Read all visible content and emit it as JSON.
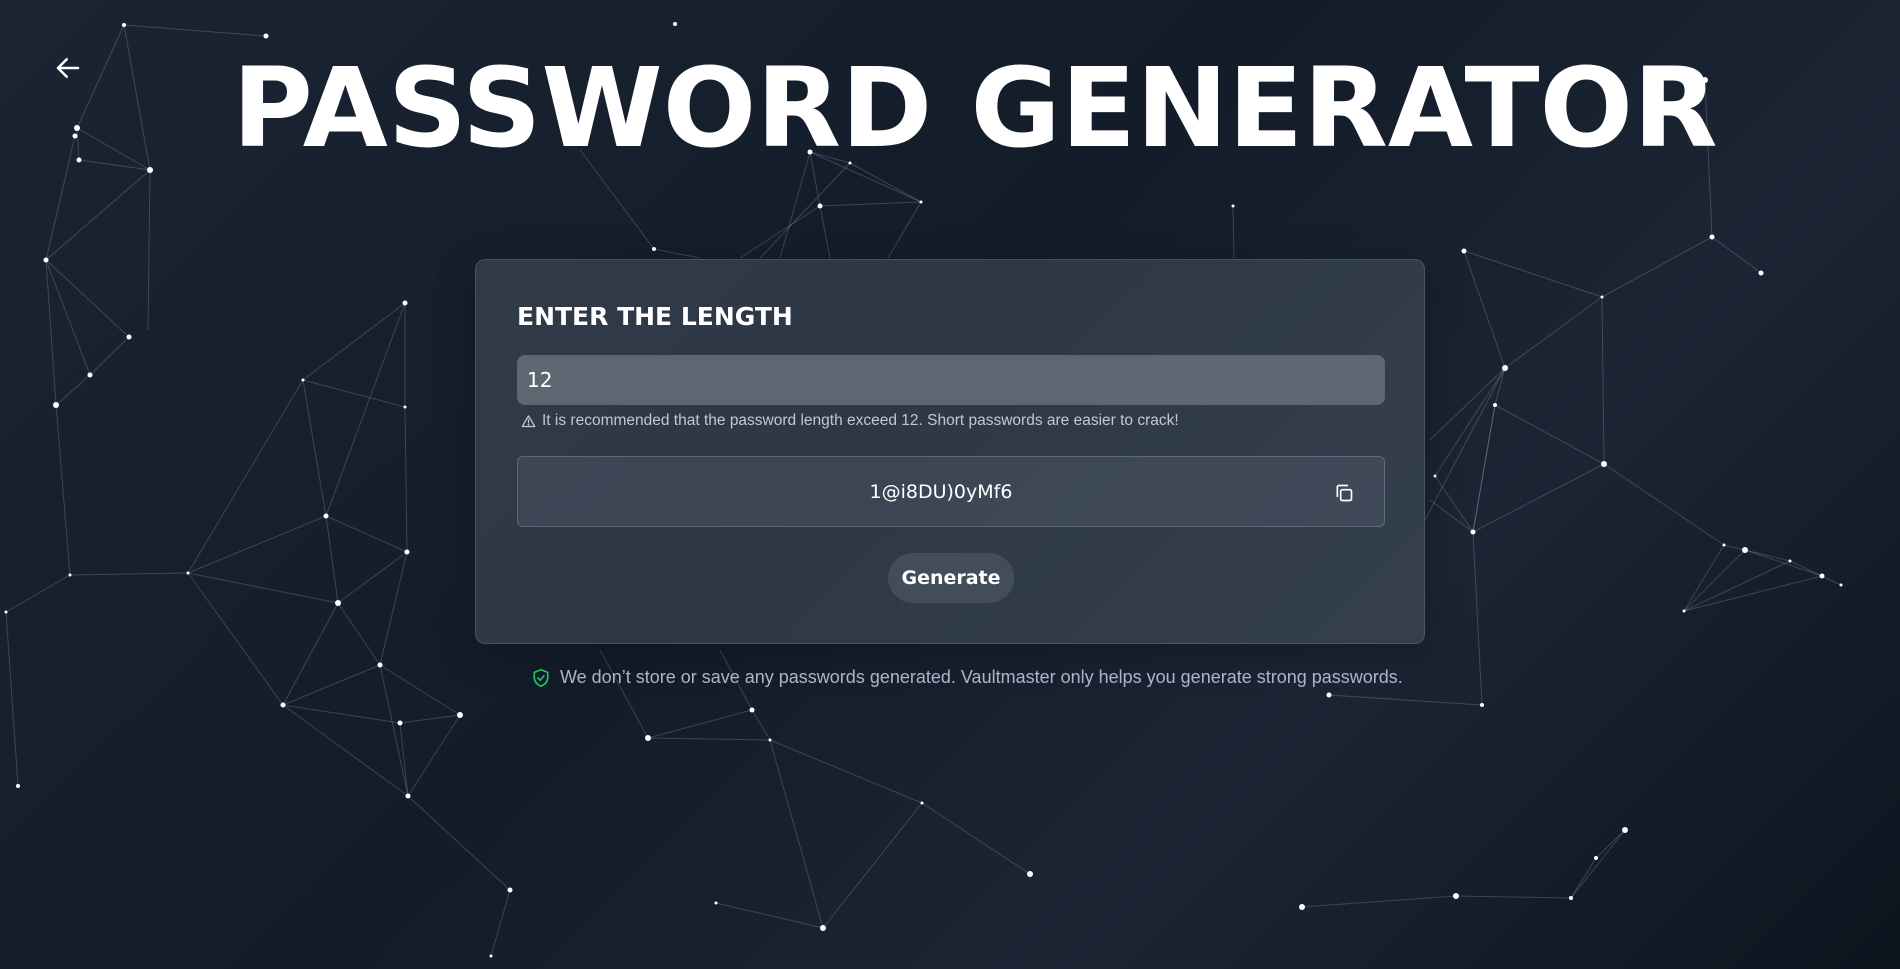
{
  "header": {
    "back_icon": "arrow-left-icon",
    "title": "PASSWORD GENERATOR"
  },
  "card": {
    "label": "ENTER THE LENGTH",
    "length_input": {
      "value": "12"
    },
    "hint": {
      "icon": "warning-triangle-icon",
      "text": "It is recommended that the password length exceed 12. Short passwords are easier to crack!"
    },
    "password": {
      "value": "1@i8DU)0yMf6",
      "copy_icon": "copy-icon"
    },
    "generate_label": "Generate"
  },
  "footer": {
    "icon": "shield-check-icon",
    "text": "We don’t store or save any passwords generated. Vaultmaster only helps you generate strong passwords."
  },
  "colors": {
    "background": "#151e2b",
    "card": "#3b4350",
    "input": "#5e6671",
    "button": "#434c59",
    "shield_green": "#22c55e",
    "note_text": "#aab6c8"
  }
}
